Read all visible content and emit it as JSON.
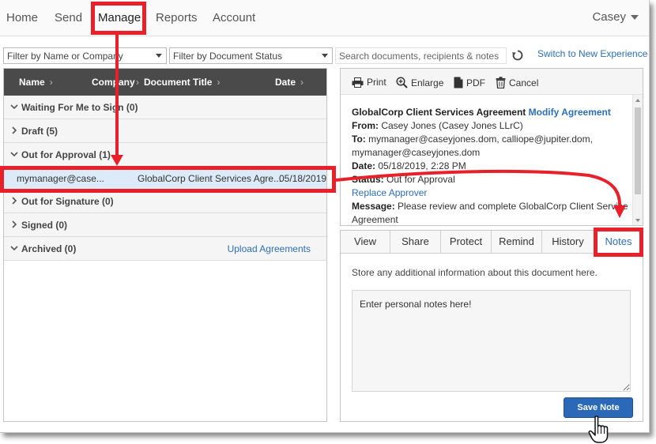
{
  "nav": {
    "items": [
      "Home",
      "Send",
      "Manage",
      "Reports",
      "Account"
    ],
    "active": "Manage",
    "user": "Casey"
  },
  "filters": {
    "name_company": "Filter by Name or Company",
    "doc_status": "Filter by Document Status",
    "search_placeholder": "Search documents, recipients & notes",
    "switch_link": "Switch to New Experience"
  },
  "list": {
    "columns": [
      "Name",
      "Company",
      "Document Title",
      "Date"
    ],
    "groups": [
      {
        "label": "Waiting For Me to Sign (0)",
        "expanded": true
      },
      {
        "label": "Draft (5)",
        "expanded": false
      },
      {
        "label": "Out for Approval (1)",
        "expanded": true
      },
      {
        "label": "Out for Signature (0)",
        "expanded": false
      },
      {
        "label": "Signed (0)",
        "expanded": false
      },
      {
        "label": "Archived (0)",
        "expanded": true
      }
    ],
    "upload_link": "Upload Agreements",
    "selected_row": {
      "name": "mymanager@case...",
      "title": "GlobalCorp Client Services Agre...",
      "date": "05/18/2019"
    }
  },
  "toolbar": {
    "print": "Print",
    "enlarge": "Enlarge",
    "pdf": "PDF",
    "cancel": "Cancel"
  },
  "details": {
    "agreement_title": "GlobalCorp Client Services Agreement",
    "modify_link": "Modify Agreement",
    "from_label": "From:",
    "from_value": "Casey Jones (Casey Jones LLrC)",
    "to_label": "To:",
    "to_value": "mymanager@caseyjones.dom, calliope@jupiter.dom,",
    "to_value_2": "mymanager@caseyjones.dom",
    "date_label": "Date:",
    "date_value": "05/18/2019, 2:28 PM",
    "status_label": "Status:",
    "status_value": "Out for Approval",
    "replace_link": "Replace Approver",
    "message_label": "Message:",
    "message_value": "Please review and complete GlobalCorp Client Services",
    "message_value_2": "Agreement"
  },
  "tabs": [
    "View",
    "Share",
    "Protect",
    "Remind",
    "History",
    "Notes"
  ],
  "active_tab": "Notes",
  "notes": {
    "hint": "Store any additional information about this document here.",
    "placeholder": "Enter personal notes here!",
    "save_label": "Save Note"
  },
  "colors": {
    "accent": "#2d6fb6",
    "callout": "#e8202a",
    "header_bg": "#4a4a4a",
    "selected_row": "#dcebf7",
    "button": "#2b69b8"
  }
}
